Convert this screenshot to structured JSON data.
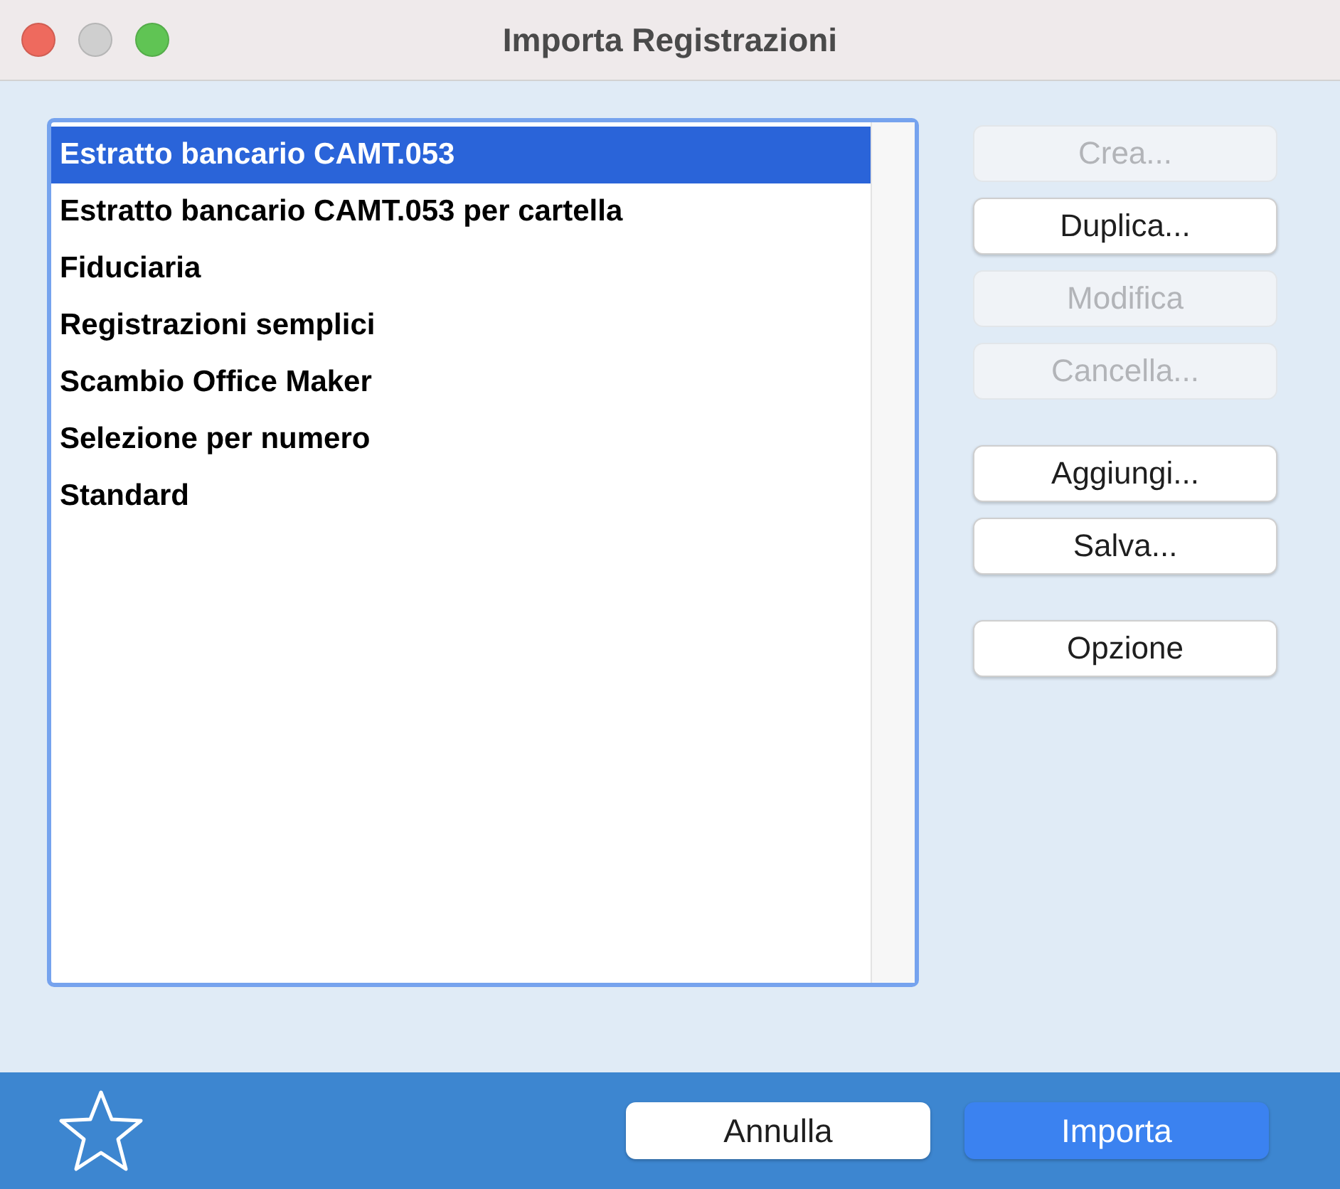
{
  "window": {
    "title": "Importa Registrazioni"
  },
  "list": {
    "items": [
      {
        "label": "Estratto bancario CAMT.053",
        "selected": true
      },
      {
        "label": "Estratto bancario CAMT.053 per cartella",
        "selected": false
      },
      {
        "label": "Fiduciaria",
        "selected": false
      },
      {
        "label": "Registrazioni semplici",
        "selected": false
      },
      {
        "label": "Scambio Office Maker",
        "selected": false
      },
      {
        "label": "Selezione per numero",
        "selected": false
      },
      {
        "label": "Standard",
        "selected": false
      }
    ]
  },
  "button_groups": [
    [
      {
        "label": "Crea...",
        "disabled": true
      },
      {
        "label": "Duplica...",
        "disabled": false
      },
      {
        "label": "Modifica",
        "disabled": true
      },
      {
        "label": "Cancella...",
        "disabled": true
      }
    ],
    [
      {
        "label": "Aggiungi...",
        "disabled": false
      },
      {
        "label": "Salva...",
        "disabled": false
      }
    ],
    [
      {
        "label": "Opzione",
        "disabled": false
      }
    ]
  ],
  "footer": {
    "buttons": [
      {
        "label": "Annulla",
        "kind": "secondary"
      },
      {
        "label": "Importa",
        "kind": "primary"
      }
    ]
  }
}
